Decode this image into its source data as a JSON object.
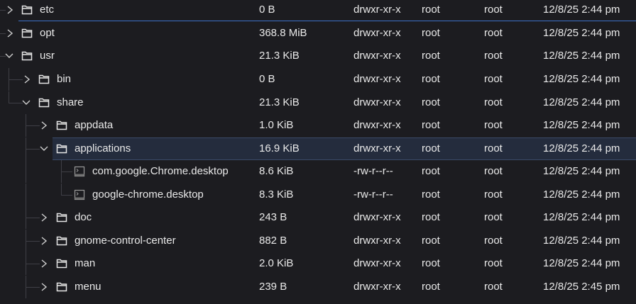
{
  "rows": [
    {
      "name": "etc",
      "size": "0 B",
      "perm": "drwxr-xr-x",
      "owner": "root",
      "group": "root",
      "date": "12/8/25 2:44 pm"
    },
    {
      "name": "opt",
      "size": "368.8 MiB",
      "perm": "drwxr-xr-x",
      "owner": "root",
      "group": "root",
      "date": "12/8/25 2:44 pm"
    },
    {
      "name": "usr",
      "size": "21.3 KiB",
      "perm": "drwxr-xr-x",
      "owner": "root",
      "group": "root",
      "date": "12/8/25 2:44 pm"
    },
    {
      "name": "bin",
      "size": "0 B",
      "perm": "drwxr-xr-x",
      "owner": "root",
      "group": "root",
      "date": "12/8/25 2:44 pm"
    },
    {
      "name": "share",
      "size": "21.3 KiB",
      "perm": "drwxr-xr-x",
      "owner": "root",
      "group": "root",
      "date": "12/8/25 2:44 pm"
    },
    {
      "name": "appdata",
      "size": "1.0 KiB",
      "perm": "drwxr-xr-x",
      "owner": "root",
      "group": "root",
      "date": "12/8/25 2:44 pm"
    },
    {
      "name": "applications",
      "size": "16.9 KiB",
      "perm": "drwxr-xr-x",
      "owner": "root",
      "group": "root",
      "date": "12/8/25 2:44 pm"
    },
    {
      "name": "com.google.Chrome.desktop",
      "size": "8.6 KiB",
      "perm": "-rw-r--r--",
      "owner": "root",
      "group": "root",
      "date": "12/8/25 2:44 pm"
    },
    {
      "name": "google-chrome.desktop",
      "size": "8.3 KiB",
      "perm": "-rw-r--r--",
      "owner": "root",
      "group": "root",
      "date": "12/8/25 2:44 pm"
    },
    {
      "name": "doc",
      "size": "243 B",
      "perm": "drwxr-xr-x",
      "owner": "root",
      "group": "root",
      "date": "12/8/25 2:44 pm"
    },
    {
      "name": "gnome-control-center",
      "size": "882 B",
      "perm": "drwxr-xr-x",
      "owner": "root",
      "group": "root",
      "date": "12/8/25 2:44 pm"
    },
    {
      "name": "man",
      "size": "2.0 KiB",
      "perm": "drwxr-xr-x",
      "owner": "root",
      "group": "root",
      "date": "12/8/25 2:44 pm"
    },
    {
      "name": "menu",
      "size": "239 B",
      "perm": "drwxr-xr-x",
      "owner": "root",
      "group": "root",
      "date": "12/8/25 2:45 pm"
    }
  ],
  "icons": {
    "folder": "folder-icon",
    "file": "desktop-file-icon",
    "collapsed": "chevron-right-icon",
    "expanded": "chevron-down-icon"
  },
  "colors": {
    "background": "#1c1c20",
    "text": "#e9e9e9",
    "selection": "#242c3d",
    "drop_indicator": "#3c70c8",
    "guide": "#3f3f46"
  }
}
